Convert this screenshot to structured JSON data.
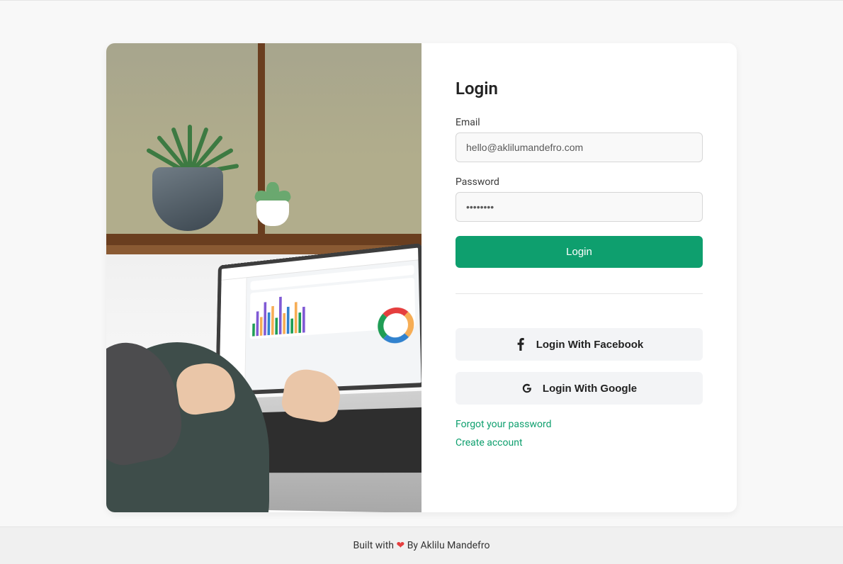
{
  "heading": "Login",
  "email": {
    "label": "Email",
    "value": "hello@aklilumandefro.com"
  },
  "password": {
    "label": "Password",
    "value": "••••••••"
  },
  "login_button": "Login",
  "facebook_button": "Login With Facebook",
  "google_button": "Login With Google",
  "link_forgot": "Forgot your password",
  "link_create": "Create account",
  "footer_prefix": "Built with",
  "footer_suffix": "By Aklilu Mandefro",
  "colors": {
    "primary": "#0e9f6e",
    "heart": "#e53e3e"
  }
}
